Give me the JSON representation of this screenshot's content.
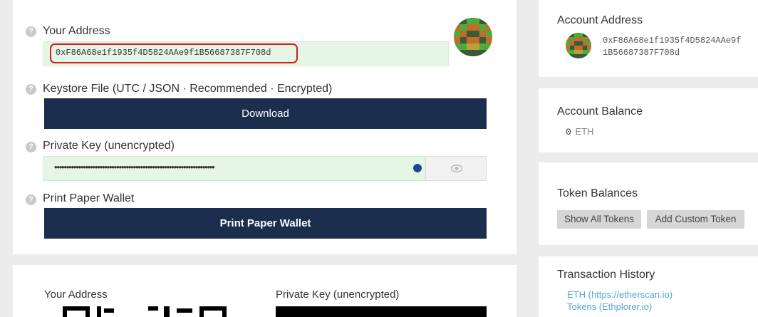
{
  "wallet": {
    "your_address_label": "Your Address",
    "address": "0xF86A68e1f1935f4D5824AAe9f1B56687387F708d",
    "keystore_label": "Keystore File (UTC / JSON · Recommended · Encrypted)",
    "download_button": "Download",
    "private_key_label": "Private Key (unencrypted)",
    "private_key_masked": "•••••••••••••••••••••••••••••••••••••••••••••••••••••••••••••••••••",
    "print_label": "Print Paper Wallet",
    "print_button": "Print Paper Wallet",
    "help_glyph": "?"
  },
  "paper": {
    "address_label": "Your Address",
    "private_key_label": "Private Key (unencrypted)"
  },
  "sidebar": {
    "account_address_title": "Account Address",
    "address_line1": "0xF86A68e1f1935f4D5824AAe9f",
    "address_line2": "1B56687387F708d",
    "balance_title": "Account Balance",
    "balance_value": "0",
    "balance_unit": "ETH",
    "tokens_title": "Token Balances",
    "show_all_tokens": "Show All Tokens",
    "add_custom_token": "Add Custom Token",
    "history_title": "Transaction History",
    "history_links": [
      "ETH (https://etherscan.io)",
      "Tokens (Ethplorer.io)"
    ]
  },
  "colors": {
    "dark_button": "#1b2e4d",
    "field_green": "#e6f6e6",
    "highlight_red": "#cc1f1f",
    "link_blue": "#52a6d8"
  },
  "icons": [
    "help-icon",
    "identicon-avatar",
    "eye-icon",
    "lock-badge-icon"
  ]
}
